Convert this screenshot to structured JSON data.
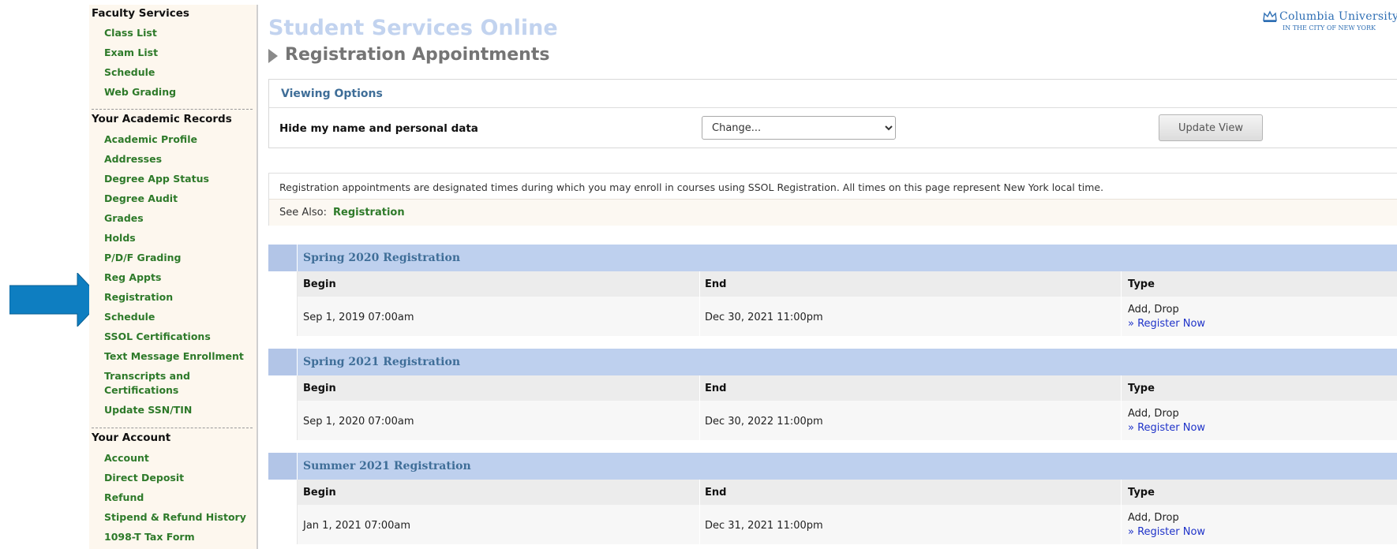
{
  "header": {
    "site_title": "Student Services Online",
    "page_title": "Registration Appointments",
    "logo_name": "Columbia University",
    "logo_sub": "IN THE CITY OF NEW YORK"
  },
  "sidebar": {
    "sections": [
      {
        "title": "Faculty Services",
        "items": [
          "Class List",
          "Exam List",
          "Schedule",
          "Web Grading"
        ]
      },
      {
        "title": "Your Academic Records",
        "items": [
          "Academic Profile",
          "Addresses",
          "Degree App Status",
          "Degree Audit",
          "Grades",
          "Holds",
          "P/D/F Grading",
          "Reg Appts",
          "Registration",
          "Schedule",
          "SSOL Certifications",
          "Text Message Enrollment",
          "Transcripts and",
          "Certifications",
          "Update SSN/TIN"
        ]
      },
      {
        "title": "Your Account",
        "items": [
          "Account",
          "Direct Deposit",
          "Refund",
          "Stipend & Refund History",
          "1098-T Tax Form"
        ]
      }
    ]
  },
  "viewing_options": {
    "title": "Viewing Options",
    "label": "Hide my name and personal data",
    "select_value": "Change...",
    "button_label": "Update View"
  },
  "info": {
    "text": "Registration appointments are designated times during which you may enroll in courses using SSOL Registration. All times on this page represent New York local time.",
    "see_also_label": "See Also:",
    "see_also_link": "Registration"
  },
  "columns": {
    "begin": "Begin",
    "end": "End",
    "type": "Type"
  },
  "registrations": [
    {
      "title": "Spring 2020 Registration",
      "begin": "Sep 1, 2019 07:00am",
      "end": "Dec 30, 2021 11:00pm",
      "type": "Add, Drop",
      "link": "» Register Now"
    },
    {
      "title": "Spring 2021 Registration",
      "begin": "Sep 1, 2020 07:00am",
      "end": "Dec 30, 2022 11:00pm",
      "type": "Add, Drop",
      "link": "» Register Now"
    },
    {
      "title": "Summer 2021 Registration",
      "begin": "Jan 1, 2021 07:00am",
      "end": "Dec 31, 2021 11:00pm",
      "type": "Add, Drop",
      "link": "» Register Now"
    }
  ],
  "colors": {
    "accent_green": "#2e7a2a",
    "header_blue": "#bed0ee",
    "title_blue": "#3f6e98",
    "arrow_blue": "#0e7ec1"
  }
}
